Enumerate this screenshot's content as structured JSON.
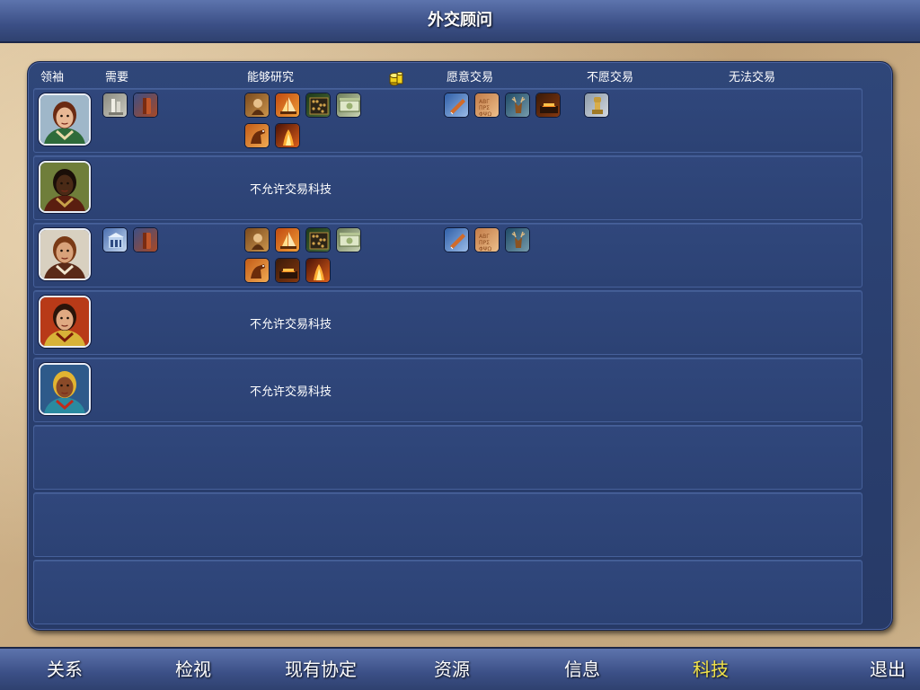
{
  "window": {
    "title": "外交顾问"
  },
  "columns": {
    "leader": "领袖",
    "needs": "需要",
    "can_research": "能够研究",
    "willing_trade": "愿意交易",
    "unwilling_trade": "不愿交易",
    "cannot_trade": "无法交易"
  },
  "rows": [
    {
      "leader": "leader-portrait-woman-green",
      "needs": [
        "monument-tech-icon",
        "bronze-working-tech-icon"
      ],
      "can_research": [
        "mysticism-tech-icon",
        "sailing-tech-icon",
        "mathematics-tech-icon",
        "currency-tech-icon",
        "horseback-tech-icon",
        "iron-working-tech-icon"
      ],
      "willing_trade": [
        "fishing-tech-icon",
        "writing-tech-icon",
        "hunting-tech-icon",
        "metal-casting-tech-icon"
      ],
      "unwilling_trade": [
        "philosophy-tech-icon"
      ],
      "cannot_trade": [],
      "message": ""
    },
    {
      "leader": "leader-portrait-african-king",
      "needs": [],
      "can_research": [],
      "willing_trade": [],
      "unwilling_trade": [],
      "cannot_trade": [],
      "message": "不允许交易科技"
    },
    {
      "leader": "leader-portrait-bearded-man",
      "needs": [
        "masonry-tech-icon",
        "bronze-working-tech-icon"
      ],
      "can_research": [
        "mysticism-tech-icon",
        "sailing-tech-icon",
        "mathematics-tech-icon",
        "currency-tech-icon",
        "horseback-tech-icon",
        "metal-casting-tech-icon",
        "iron-working-tech-icon"
      ],
      "willing_trade": [
        "fishing-tech-icon",
        "writing-tech-icon",
        "hunting-tech-icon"
      ],
      "unwilling_trade": [],
      "cannot_trade": [],
      "message": ""
    },
    {
      "leader": "leader-portrait-woman-red",
      "needs": [],
      "can_research": [],
      "willing_trade": [],
      "unwilling_trade": [],
      "cannot_trade": [],
      "message": "不允许交易科技"
    },
    {
      "leader": "leader-portrait-aztec-chief",
      "needs": [],
      "can_research": [],
      "willing_trade": [],
      "unwilling_trade": [],
      "cannot_trade": [],
      "message": "不允许交易科技"
    },
    {
      "leader": "",
      "message": ""
    },
    {
      "leader": "",
      "message": ""
    },
    {
      "leader": "",
      "message": ""
    }
  ],
  "bottom_nav": [
    {
      "label": "关系",
      "active": false
    },
    {
      "label": "检视",
      "active": false
    },
    {
      "label": "现有协定",
      "active": false
    },
    {
      "label": "资源",
      "active": false
    },
    {
      "label": "信息",
      "active": false
    },
    {
      "label": "科技",
      "active": true
    },
    {
      "label": "退出",
      "active": false
    }
  ],
  "colors": {
    "bar": "#3b4f86",
    "panel": "#2a3f6f",
    "active_tab": "#f2e34a",
    "parchment": "#d1b58d"
  }
}
